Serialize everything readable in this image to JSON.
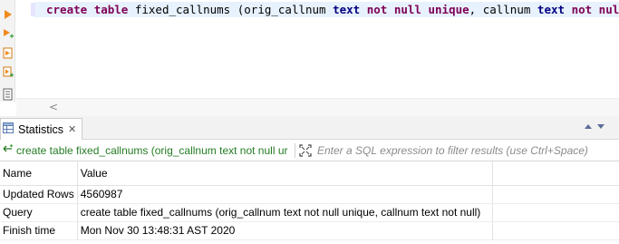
{
  "editor": {
    "sql_tokens": [
      {
        "t": "create",
        "cls": "kw"
      },
      {
        "t": " ",
        "cls": ""
      },
      {
        "t": "table",
        "cls": "kw"
      },
      {
        "t": " fixed_callnums (orig_callnum ",
        "cls": ""
      },
      {
        "t": "text",
        "cls": "kw2"
      },
      {
        "t": " ",
        "cls": ""
      },
      {
        "t": "not",
        "cls": "kw"
      },
      {
        "t": " ",
        "cls": ""
      },
      {
        "t": "null",
        "cls": "kw"
      },
      {
        "t": " ",
        "cls": ""
      },
      {
        "t": "unique",
        "cls": "kw"
      },
      {
        "t": ", callnum ",
        "cls": ""
      },
      {
        "t": "text",
        "cls": "kw2"
      },
      {
        "t": " ",
        "cls": ""
      },
      {
        "t": "not",
        "cls": "kw"
      },
      {
        "t": " ",
        "cls": ""
      },
      {
        "t": "null",
        "cls": "kw"
      },
      {
        "t": ");",
        "cls": ""
      }
    ]
  },
  "scroll": {
    "left_arrow": "<"
  },
  "results_tab": {
    "label": "Statistics",
    "close": "✕"
  },
  "filter": {
    "query_label": "create table fixed_callnums (orig_callnum text not null ur",
    "placeholder": "Enter a SQL expression to filter results (use Ctrl+Space)"
  },
  "table": {
    "headers": [
      "Name",
      "Value"
    ],
    "rows": [
      [
        "Updated Rows",
        "4560987"
      ],
      [
        "Query",
        "create table fixed_callnums (orig_callnum text not null unique, callnum text not null)"
      ],
      [
        "Finish time",
        "Mon Nov 30 13:48:31 AST 2020"
      ]
    ]
  },
  "colors": {
    "keyword": "#7f0055",
    "type_keyword": "#000080",
    "query_green": "#247c24",
    "current_line": "#e8f2fe"
  }
}
